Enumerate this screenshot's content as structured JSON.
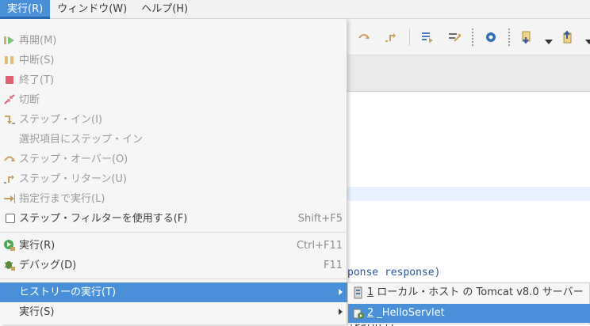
{
  "menubar": {
    "items": [
      {
        "label": "実行(R)"
      },
      {
        "label": "ウィンドウ(W)"
      },
      {
        "label": "ヘルプ(H)"
      }
    ]
  },
  "menu": {
    "items": [
      {
        "label": "再開(M)",
        "accel": "",
        "icon": "resume-icon"
      },
      {
        "label": "中断(S)",
        "accel": "",
        "icon": "suspend-icon"
      },
      {
        "label": "終了(T)",
        "accel": "",
        "icon": "terminate-icon"
      },
      {
        "label": "切断",
        "accel": "",
        "icon": "disconnect-icon"
      },
      {
        "label": "ステップ・イン(I)",
        "accel": "",
        "icon": "step-into-icon"
      },
      {
        "label": "選択項目にステップ・イン",
        "accel": ""
      },
      {
        "label": "ステップ・オーバー(O)",
        "accel": "",
        "icon": "step-over-icon"
      },
      {
        "label": "ステップ・リターン(U)",
        "accel": "",
        "icon": "step-return-icon"
      },
      {
        "label": "指定行まで実行(L)",
        "accel": "",
        "icon": "run-to-line-icon"
      },
      {
        "label": "ステップ・フィルターを使用する(F)",
        "accel": "Shift+F5",
        "checked": false
      },
      {
        "label": "実行(R)",
        "accel": "Ctrl+F11",
        "icon": "run-icon"
      },
      {
        "label": "デバッグ(D)",
        "accel": "F11",
        "icon": "debug-icon"
      },
      {
        "label": "ヒストリーの実行(T)",
        "accel": "",
        "submenu": true
      },
      {
        "label": "実行(S)",
        "accel": "",
        "submenu": true
      }
    ]
  },
  "submenu": {
    "items": [
      {
        "num": "1",
        "label": "ローカル・ホスト の Tomcat v8.0 サーバー",
        "icon": "server-icon"
      },
      {
        "num": "2",
        "label": "_HelloServlet",
        "icon": "java-app-icon"
      }
    ]
  },
  "editor": {
    "code_line": "ponse response)",
    "code_fragment": "tPath())"
  },
  "colors": {
    "selection": "#4a90d9",
    "menu_bg": "#f6f6f6",
    "disabled_text": "#9a9a9a"
  }
}
